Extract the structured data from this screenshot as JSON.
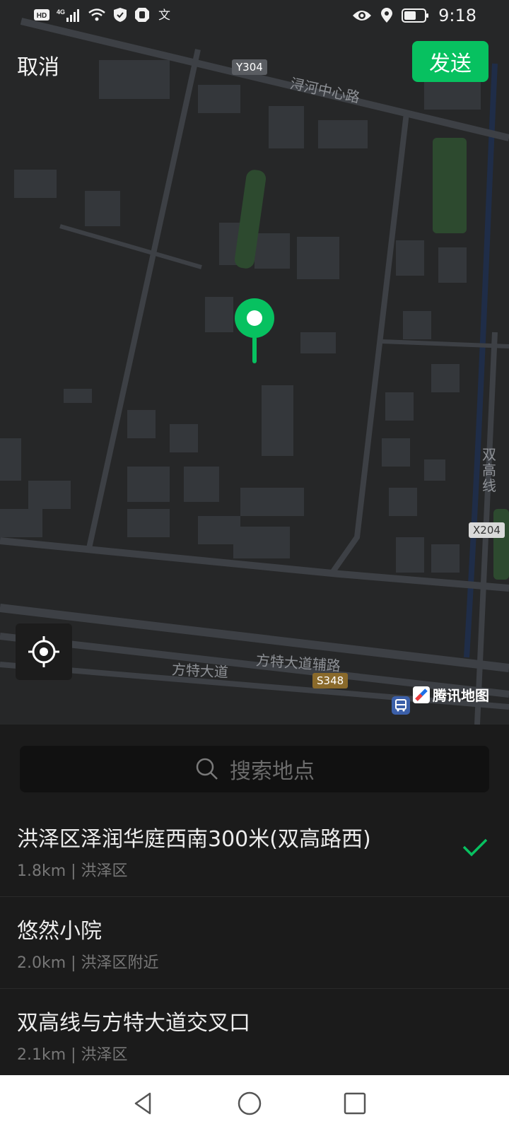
{
  "status_bar": {
    "time": "9:18",
    "icons": [
      "hd-icon",
      "signal-4g-icon",
      "wifi-icon",
      "shield-icon",
      "hand-icon",
      "translate-icon",
      "eye-icon",
      "location-icon",
      "battery-icon"
    ]
  },
  "header": {
    "cancel_label": "取消",
    "send_label": "发送"
  },
  "map": {
    "road_labels": {
      "xunhe": "浔河中心路",
      "fangte": "方特大道",
      "fangte_aux": "方特大道辅路",
      "shuanggao": "双\n高\n线"
    },
    "shields": {
      "y304": "Y304",
      "s348": "S348",
      "x204": "X204"
    },
    "logo_text": "腾讯地图"
  },
  "search": {
    "placeholder": "搜索地点"
  },
  "results": [
    {
      "name": "洪泽区泽润华庭西南300米(双高路西)",
      "sub": "1.8km | 洪泽区",
      "selected": true
    },
    {
      "name": "悠然小院",
      "sub": "2.0km | 洪泽区附近",
      "selected": false
    },
    {
      "name": "双高线与方特大道交叉口",
      "sub": "2.1km | 洪泽区",
      "selected": false
    }
  ],
  "colors": {
    "accent": "#07c160",
    "map_bg": "#262728",
    "sheet_bg": "#1b1b1b"
  }
}
